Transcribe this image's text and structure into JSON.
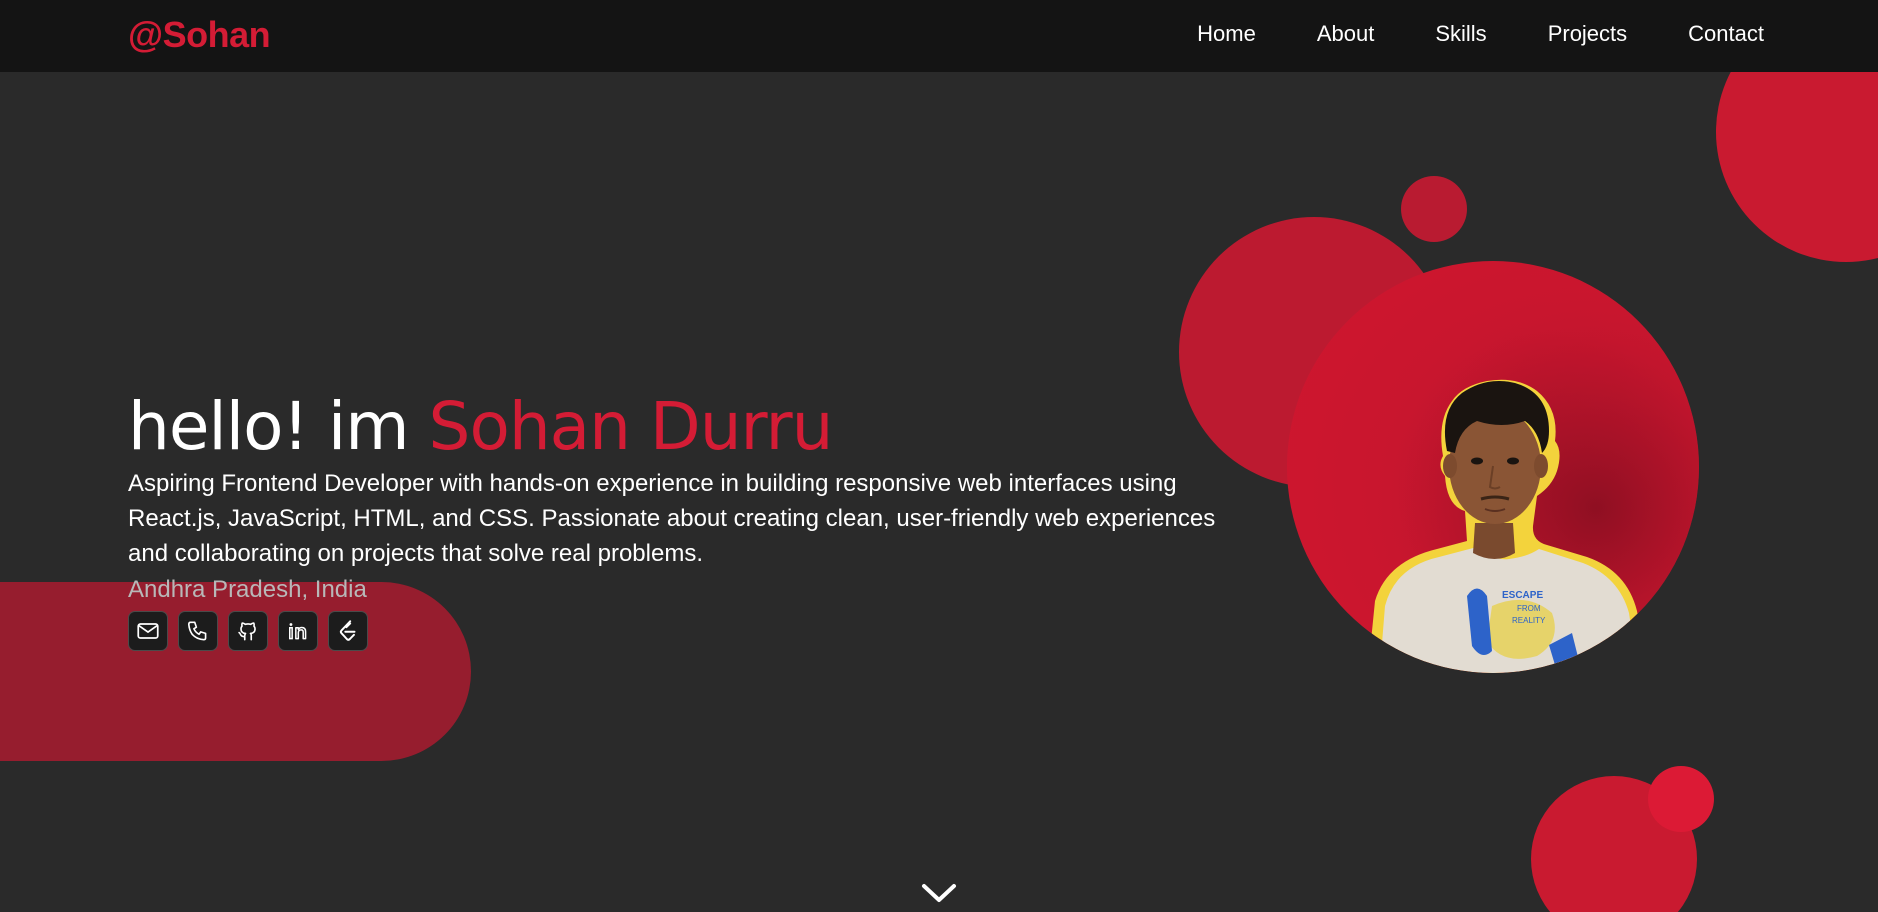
{
  "brand": {
    "logo_text": "@Sohan",
    "accent": "#d41c35"
  },
  "nav": {
    "items": [
      {
        "label": "Home"
      },
      {
        "label": "About"
      },
      {
        "label": "Skills"
      },
      {
        "label": "Projects"
      },
      {
        "label": "Contact"
      }
    ]
  },
  "hero": {
    "greeting": "hello! im ",
    "name": "Sohan Durru",
    "description": "Aspiring Frontend Developer with hands-on experience in building responsive web interfaces using React.js, JavaScript, HTML, and CSS. Passionate about creating clean, user-friendly web experiences and collaborating on projects that solve real problems.",
    "location": "Andhra Pradesh, India"
  },
  "socials": [
    {
      "icon": "mail-icon"
    },
    {
      "icon": "phone-icon"
    },
    {
      "icon": "github-icon"
    },
    {
      "icon": "linkedin-icon"
    },
    {
      "icon": "code-profile-icon"
    }
  ],
  "photo": {
    "shirt_text": "ESCAPE FROM REALITY"
  },
  "scroll": {
    "icon": "chevron-down-icon"
  }
}
